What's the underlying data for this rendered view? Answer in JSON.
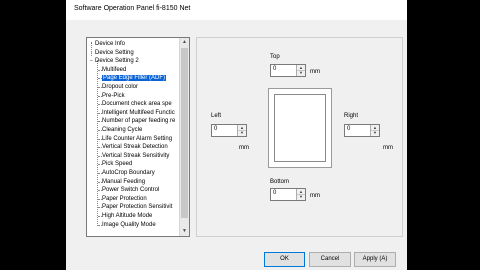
{
  "window": {
    "title": "Software Operation Panel fi-8150 Net"
  },
  "tree": {
    "items": [
      {
        "label": "Device Info",
        "level": 0,
        "expander": ""
      },
      {
        "label": "Device Setting",
        "level": 0,
        "expander": ""
      },
      {
        "label": "Device Setting 2",
        "level": 0,
        "expander": "−"
      },
      {
        "label": "Multifeed",
        "level": 1
      },
      {
        "label": "Page Edge Filler (ADF)",
        "level": 1,
        "selected": true
      },
      {
        "label": "Dropout color",
        "level": 1
      },
      {
        "label": "Pre-Pick",
        "level": 1
      },
      {
        "label": "Document check area spe",
        "level": 1
      },
      {
        "label": "Intelligent Multifeed Functic",
        "level": 1
      },
      {
        "label": "Number of paper feeding re",
        "level": 1
      },
      {
        "label": "Cleaning Cycle",
        "level": 1
      },
      {
        "label": "Life Counter Alarm Setting",
        "level": 1
      },
      {
        "label": "Vertical Streak Detection",
        "level": 1
      },
      {
        "label": "Vertical Streak Sensitivity",
        "level": 1
      },
      {
        "label": "Pick Speed",
        "level": 1
      },
      {
        "label": "AutoCrop Boundary",
        "level": 1
      },
      {
        "label": "Manual Feeding",
        "level": 1
      },
      {
        "label": "Power Switch Control",
        "level": 1
      },
      {
        "label": "Paper Protection",
        "level": 1
      },
      {
        "label": "Paper Protection Sensitivit",
        "level": 1
      },
      {
        "label": "High Altitude Mode",
        "level": 1
      },
      {
        "label": "Image Quality Mode",
        "level": 1
      }
    ]
  },
  "panel": {
    "top": {
      "label": "Top",
      "value": "0",
      "unit": "mm"
    },
    "left": {
      "label": "Left",
      "value": "0",
      "unit": "mm"
    },
    "right": {
      "label": "Right",
      "value": "0",
      "unit": "mm"
    },
    "bottom": {
      "label": "Bottom",
      "value": "0",
      "unit": "mm"
    }
  },
  "buttons": {
    "ok": "OK",
    "cancel": "Cancel",
    "apply": "Apply (A)"
  }
}
